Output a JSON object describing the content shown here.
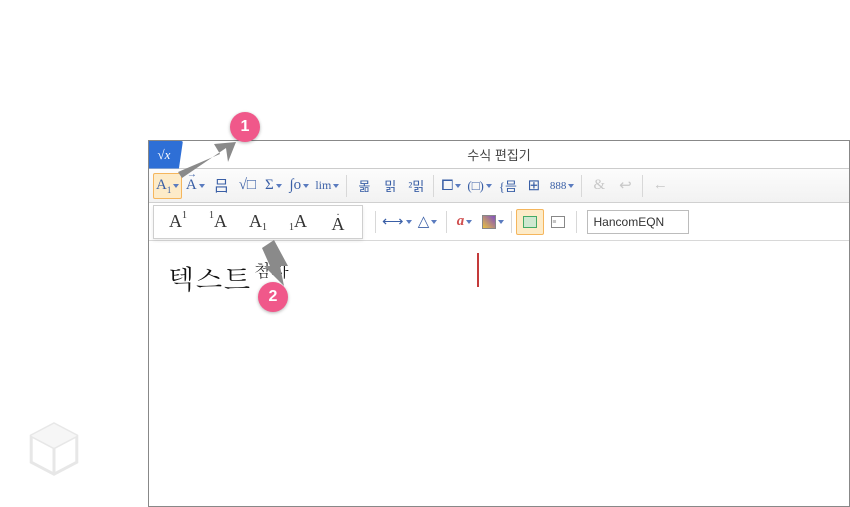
{
  "title": "수식 편집기",
  "app_icon_text": "√x",
  "toolbar": {
    "script_btn": "A",
    "script_sub": "1",
    "accent_btn": "A",
    "frac_btn": "吕",
    "radical_btn": "√□",
    "sum_btn": "Σ",
    "integral_btn": "∫о",
    "limit_btn": "lim",
    "align_a": "몲",
    "align_b": "밁",
    "align_c": "²밁",
    "bracket_btn": "⧠",
    "paren_btn": "(□)",
    "brace_btn": "{믐",
    "grid_btn": "⊞",
    "matrix_btn": "888",
    "amp_btn": "&",
    "hookleft": "↩",
    "hookarrow": "←"
  },
  "dropdown": {
    "item1_main": "A",
    "item1_sup": "1",
    "item2_pre": "1",
    "item2_main": "A",
    "item3_main": "A",
    "item3_sub": "1",
    "item4_pre": "1",
    "item4_main": "A",
    "item5_main": "A",
    "item5_dot": "·"
  },
  "toolbar2": {
    "arrow_btn": "⟷",
    "triangle_btn": "△",
    "color_a_btn": "a",
    "font_name": "HancomEQN"
  },
  "canvas": {
    "left_text": "텍스트",
    "sup_text": "첨자"
  },
  "annotations": {
    "one": "1",
    "two": "2"
  }
}
